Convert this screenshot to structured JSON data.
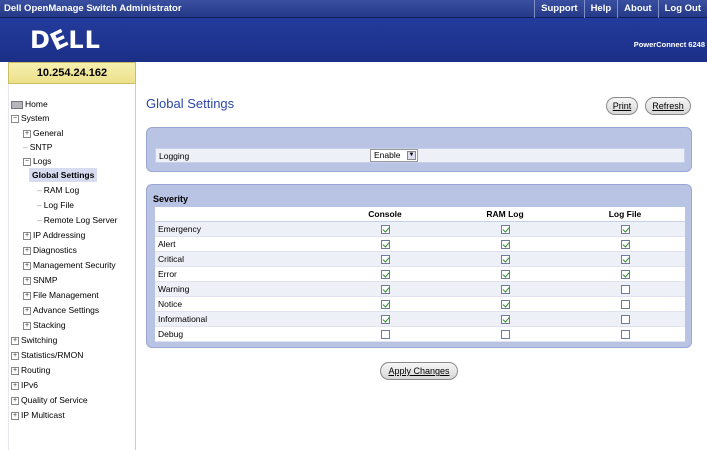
{
  "topbar": {
    "title": "Dell OpenManage Switch Administrator",
    "links": [
      "Support",
      "Help",
      "About",
      "Log Out"
    ]
  },
  "header": {
    "logo_text": "DELL",
    "model": "PowerConnect 6248"
  },
  "ip_address": "10.254.24.162",
  "sidebar": {
    "items": [
      {
        "label": "Home",
        "icon": "home-icon"
      },
      {
        "label": "System",
        "toggle": "−"
      },
      {
        "label": "General",
        "toggle": "+"
      },
      {
        "label": "SNTP"
      },
      {
        "label": "Logs",
        "toggle": "−"
      },
      {
        "label": "Global Settings",
        "selected": true
      },
      {
        "label": "RAM Log"
      },
      {
        "label": "Log File"
      },
      {
        "label": "Remote Log Server"
      },
      {
        "label": "IP Addressing",
        "toggle": "+"
      },
      {
        "label": "Diagnostics",
        "toggle": "+"
      },
      {
        "label": "Management Security",
        "toggle": "+"
      },
      {
        "label": "SNMP",
        "toggle": "+"
      },
      {
        "label": "File Management",
        "toggle": "+"
      },
      {
        "label": "Advance Settings",
        "toggle": "+"
      },
      {
        "label": "Stacking",
        "toggle": "+"
      },
      {
        "label": "Switching",
        "toggle": "+"
      },
      {
        "label": "Statistics/RMON",
        "toggle": "+"
      },
      {
        "label": "Routing",
        "toggle": "+"
      },
      {
        "label": "IPv6",
        "toggle": "+"
      },
      {
        "label": "Quality of Service",
        "toggle": "+"
      },
      {
        "label": "IP Multicast",
        "toggle": "+"
      }
    ]
  },
  "main": {
    "page_title": "Global Settings",
    "print_label": "Print",
    "refresh_label": "Refresh",
    "logging": {
      "label": "Logging",
      "value": "Enable"
    },
    "severity": {
      "title": "Severity",
      "columns": [
        "Console",
        "RAM Log",
        "Log File"
      ],
      "rows": [
        {
          "name": "Emergency",
          "values": [
            true,
            true,
            true
          ]
        },
        {
          "name": "Alert",
          "values": [
            true,
            true,
            true
          ]
        },
        {
          "name": "Critical",
          "values": [
            true,
            true,
            true
          ]
        },
        {
          "name": "Error",
          "values": [
            true,
            true,
            true
          ]
        },
        {
          "name": "Warning",
          "values": [
            true,
            true,
            false
          ]
        },
        {
          "name": "Notice",
          "values": [
            true,
            true,
            false
          ]
        },
        {
          "name": "Informational",
          "values": [
            true,
            true,
            false
          ]
        },
        {
          "name": "Debug",
          "values": [
            false,
            false,
            false
          ]
        }
      ]
    },
    "apply_label": "Apply Changes"
  },
  "colors": {
    "header_blue": "#1b2f86",
    "title_blue": "#2b47a6",
    "panel_blue": "#b9c3e3",
    "ip_yellow": "#ebe089"
  }
}
